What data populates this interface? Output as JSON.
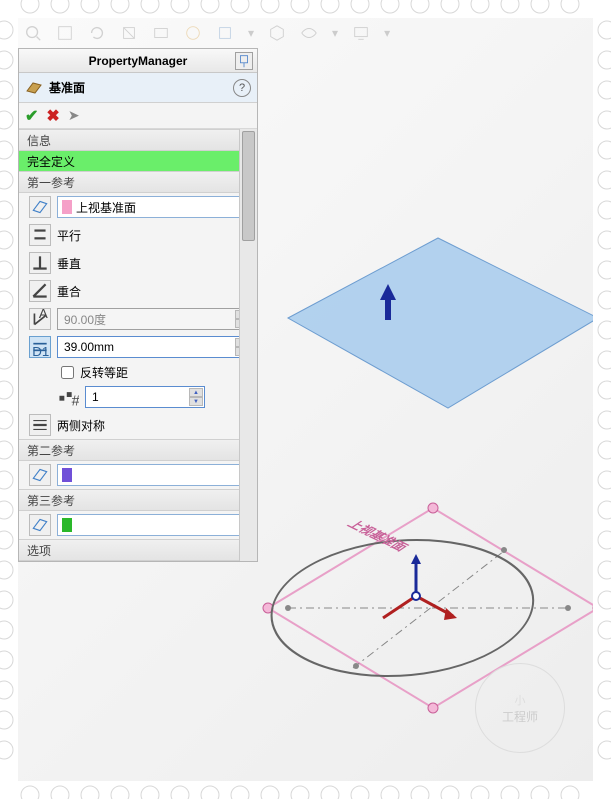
{
  "panel_title": "PropertyManager",
  "feature_name": "基准面",
  "sections": {
    "info": "信息",
    "status": "完全定义",
    "ref1": "第一参考",
    "ref2": "第二参考",
    "ref3": "第三参考",
    "options": "选项"
  },
  "ref1": {
    "selection": "上视基准面",
    "parallel": "平行",
    "perpendicular": "垂直",
    "coincident": "重合",
    "angle": "90.00度",
    "distance": "39.00mm",
    "flip_offset": "反转等距",
    "instances": "1",
    "symmetric": "两侧对称"
  },
  "plane_label": "上视基准面",
  "watermark": "工程师"
}
